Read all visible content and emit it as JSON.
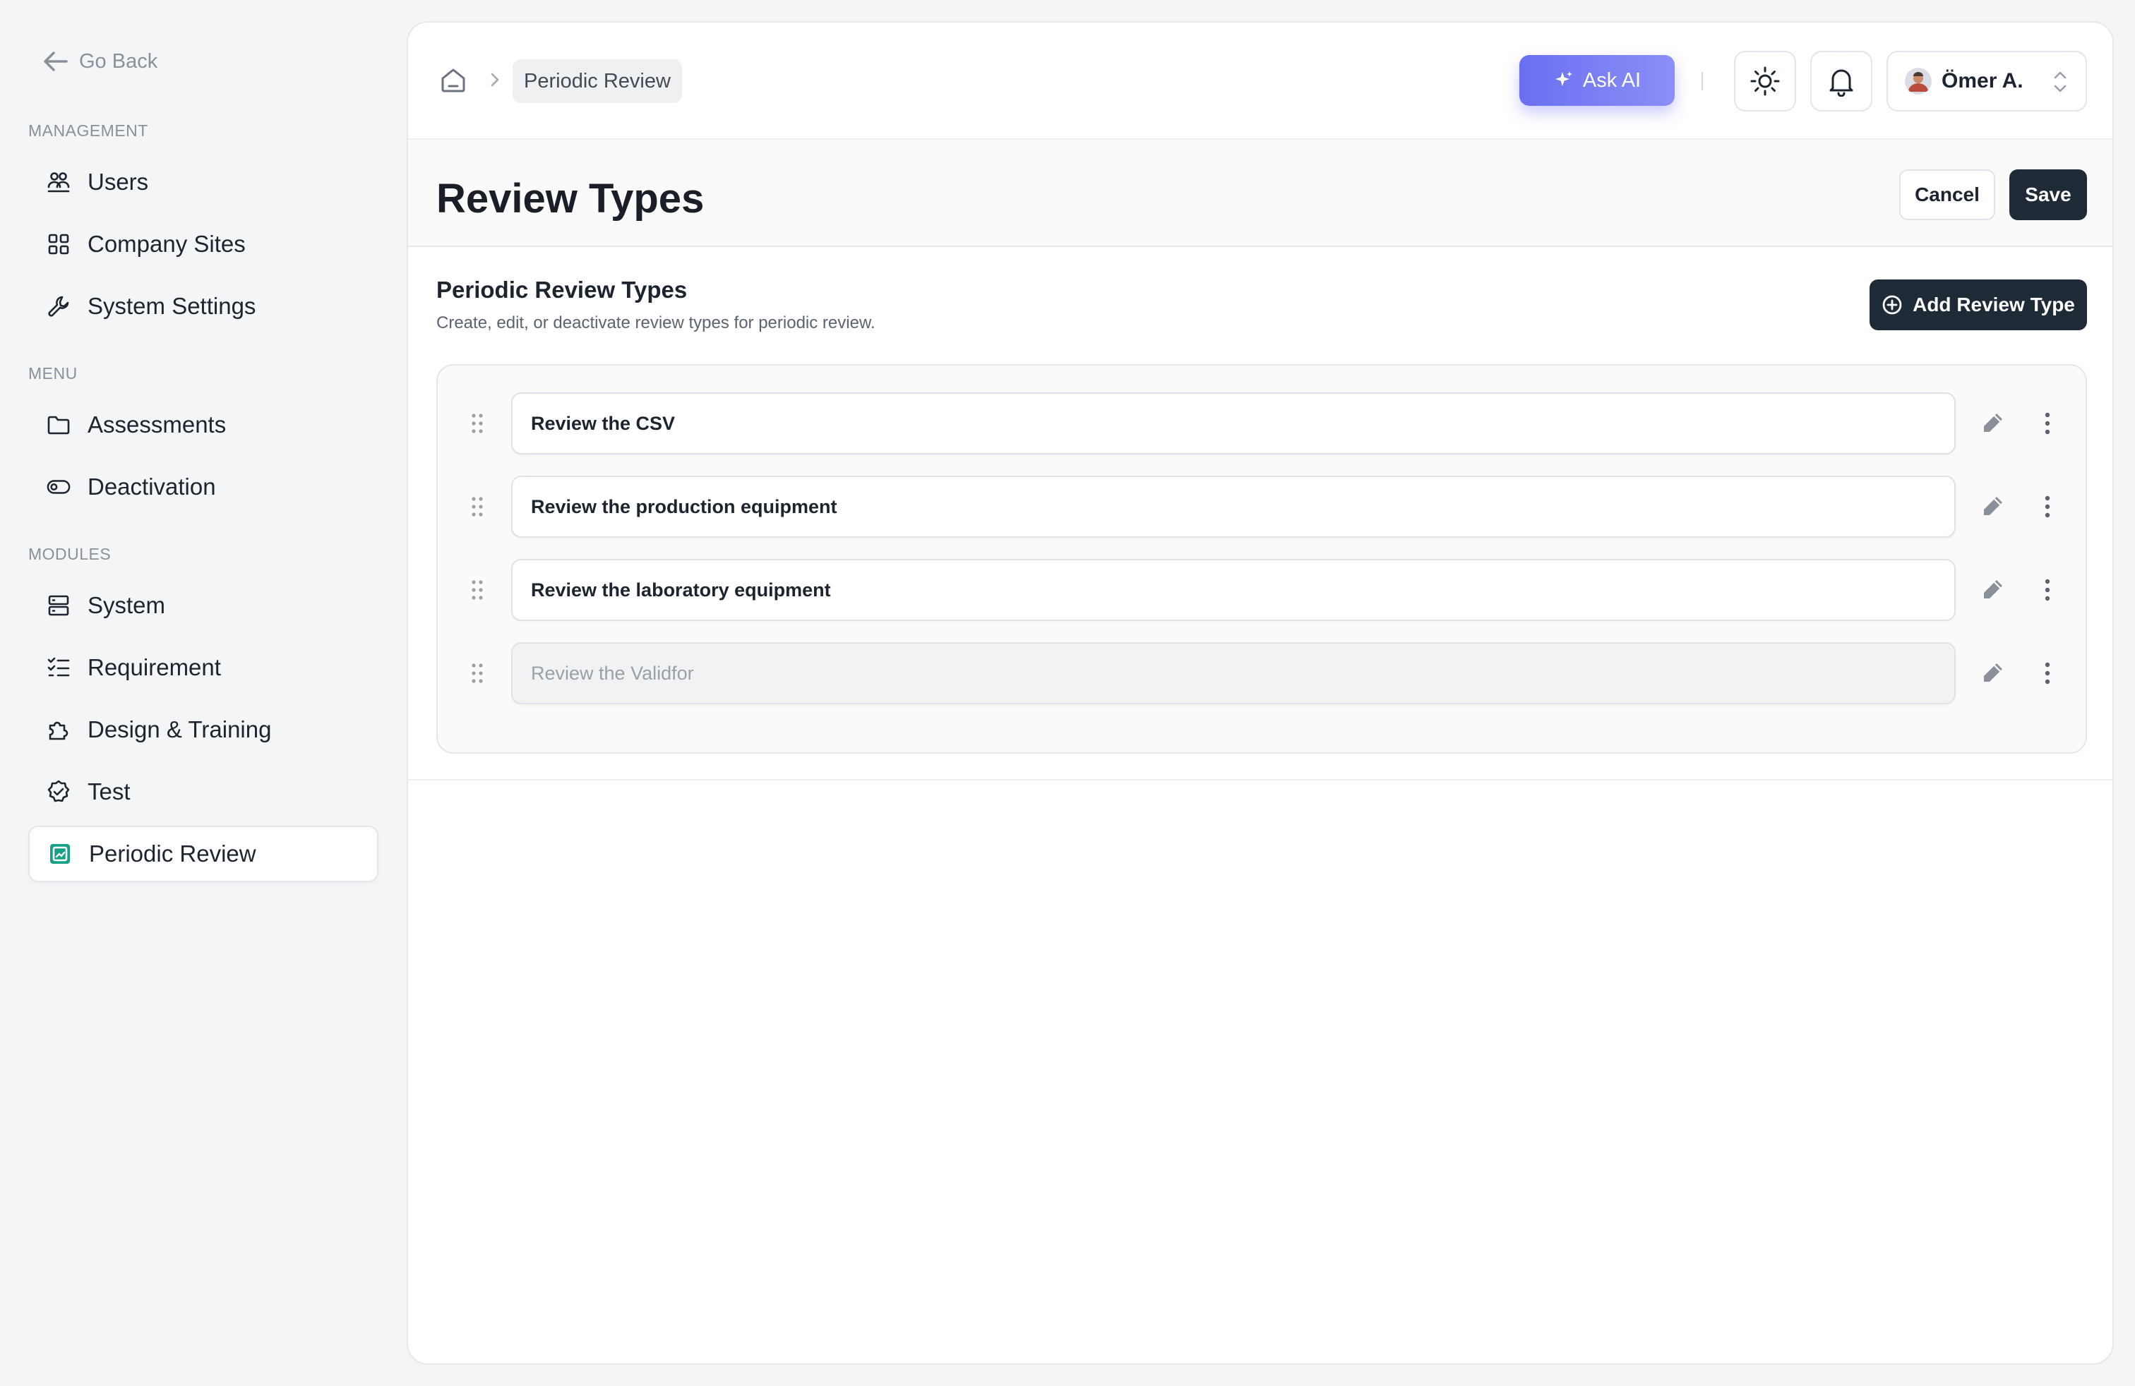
{
  "sidebar": {
    "go_back": "Go Back",
    "sections": {
      "management": "MANAGEMENT",
      "menu": "MENU",
      "modules": "MODULES"
    },
    "items": [
      {
        "label": "Users",
        "icon": "users-icon"
      },
      {
        "label": "Company Sites",
        "icon": "grid-icon"
      },
      {
        "label": "System Settings",
        "icon": "wrench-icon"
      },
      {
        "label": "Assessments",
        "icon": "folder-icon"
      },
      {
        "label": "Deactivation",
        "icon": "toggle-icon"
      },
      {
        "label": "System",
        "icon": "server-icon"
      },
      {
        "label": "Requirement",
        "icon": "checklist-icon"
      },
      {
        "label": "Design & Training",
        "icon": "puzzle-icon"
      },
      {
        "label": "Test",
        "icon": "badge-check-icon"
      },
      {
        "label": "Periodic Review",
        "icon": "periodic-review-icon",
        "active": true
      }
    ]
  },
  "header": {
    "breadcrumb": {
      "home_icon": "home-icon",
      "current": "Periodic Review"
    },
    "ask_ai": "Ask AI",
    "theme_icon": "sun-icon",
    "notification_icon": "bell-icon",
    "user": {
      "name": "Ömer A.",
      "avatar": "avatar"
    }
  },
  "page": {
    "title": "Review Types",
    "cancel_label": "Cancel",
    "save_label": "Save"
  },
  "section": {
    "title": "Periodic Review Types",
    "subtitle": "Create, edit, or deactivate review types for periodic review.",
    "add_label": "Add Review Type"
  },
  "review_types": [
    {
      "value": "Review the CSV",
      "disabled": false
    },
    {
      "value": "Review the production equipment",
      "disabled": false
    },
    {
      "value": "Review the laboratory equipment",
      "disabled": false
    },
    {
      "value": "Review the Validfor",
      "disabled": true
    }
  ],
  "colors": {
    "accent": "#6a6ff2",
    "dark_button": "#1f2a37",
    "active_icon": "#16a085",
    "background": "#f4f5f7"
  }
}
